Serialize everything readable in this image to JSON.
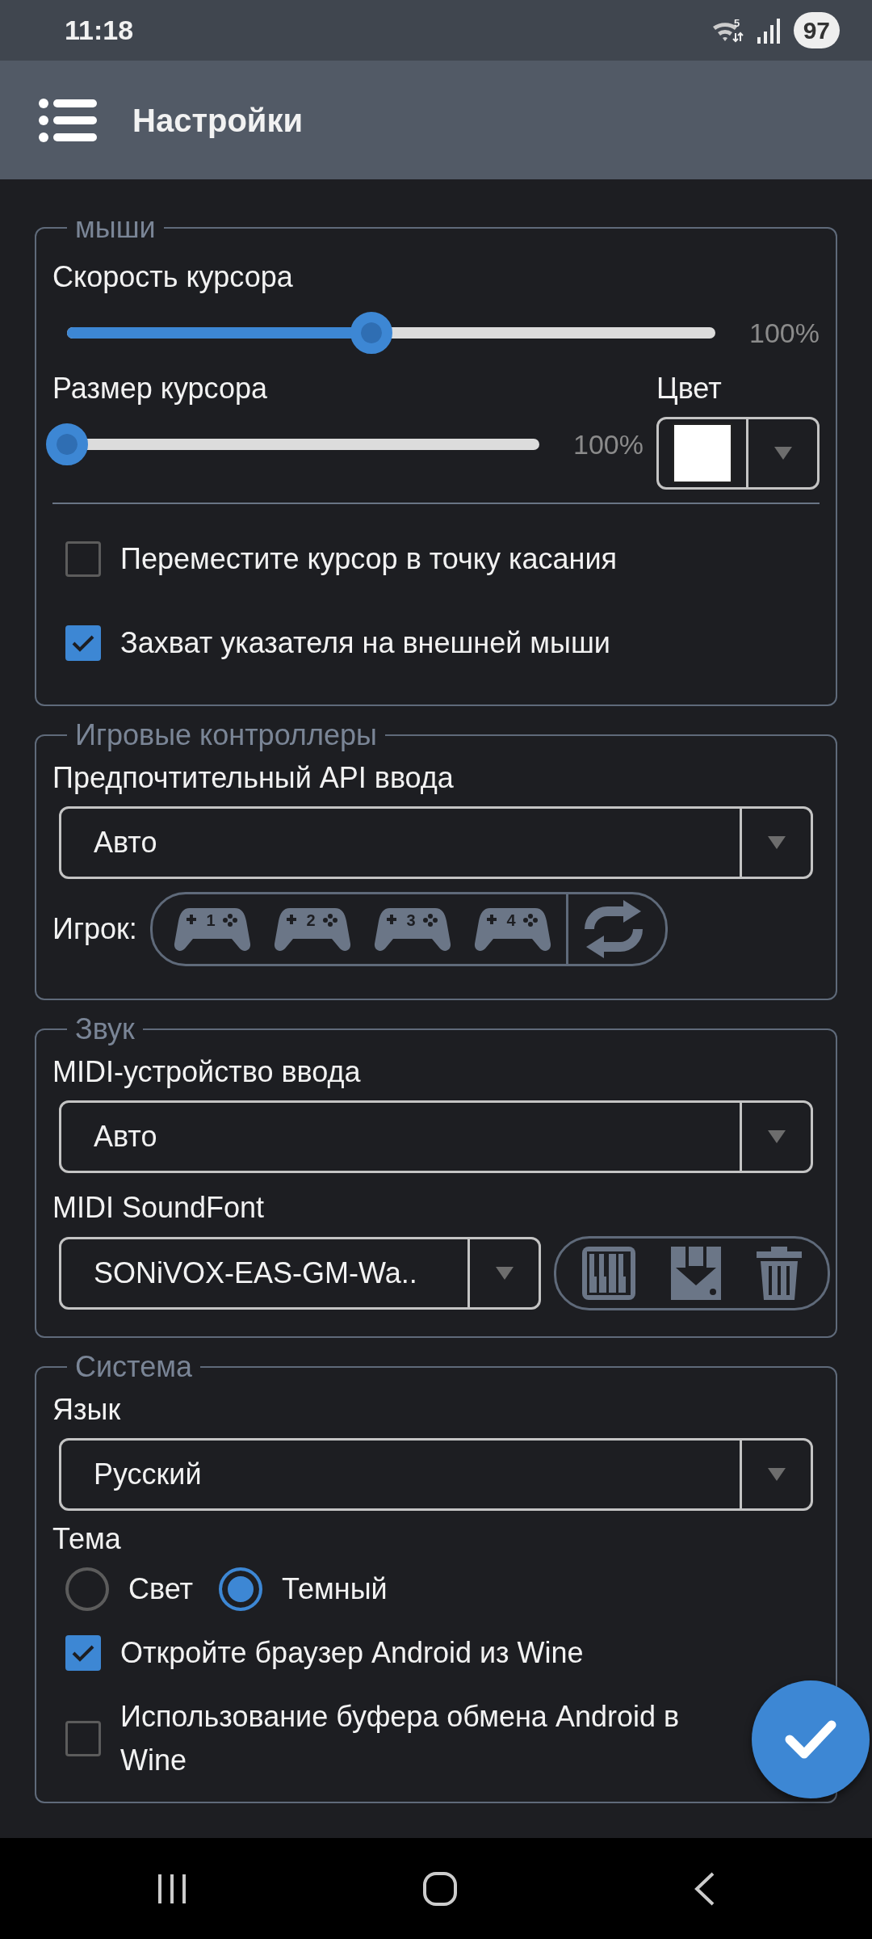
{
  "status_bar": {
    "time": "11:18",
    "network": "5",
    "battery": "97"
  },
  "app_bar": {
    "title": "Настройки"
  },
  "mouse": {
    "legend": "мыши",
    "cursor_speed": {
      "label": "Скорость курсора",
      "level": 0.47,
      "reading": "100%"
    },
    "cursor_size": {
      "label": "Размер курсора",
      "level": 0,
      "reading": "100%"
    },
    "cursor_color": {
      "label": "Цвет",
      "color": "#ffffff"
    },
    "checkboxes": [
      {
        "label": "Переместите курсор в точку касания",
        "checked": false
      },
      {
        "label": "Захват указателя на внешней мыши",
        "checked": true
      }
    ]
  },
  "game_controllers": {
    "legend": "Игровые контроллеры",
    "input_api": {
      "label": "Предпочтительный API ввода",
      "value": "Авто"
    },
    "player": {
      "label": "Игрок:",
      "players": [
        "1",
        "2",
        "3",
        "4"
      ]
    }
  },
  "sound": {
    "legend": "Звук",
    "midi_input": {
      "label": "MIDI-устройство ввода",
      "value": "Авто"
    },
    "soundfont": {
      "label": "MIDI SoundFont",
      "value": "SONiVOX-EAS-GM-Wa.."
    }
  },
  "system": {
    "legend": "Система",
    "language": {
      "label": "Язык",
      "value": "Русский"
    },
    "theme": {
      "label": "Тема",
      "options": [
        {
          "label": "Свет",
          "selected": false
        },
        {
          "label": "Темный",
          "selected": true
        }
      ]
    },
    "checkboxes": [
      {
        "label": "Откройте браузер Android из Wine",
        "checked": true
      },
      {
        "label": "Использование буфера обмена Android в Wine",
        "checked": false
      }
    ]
  }
}
